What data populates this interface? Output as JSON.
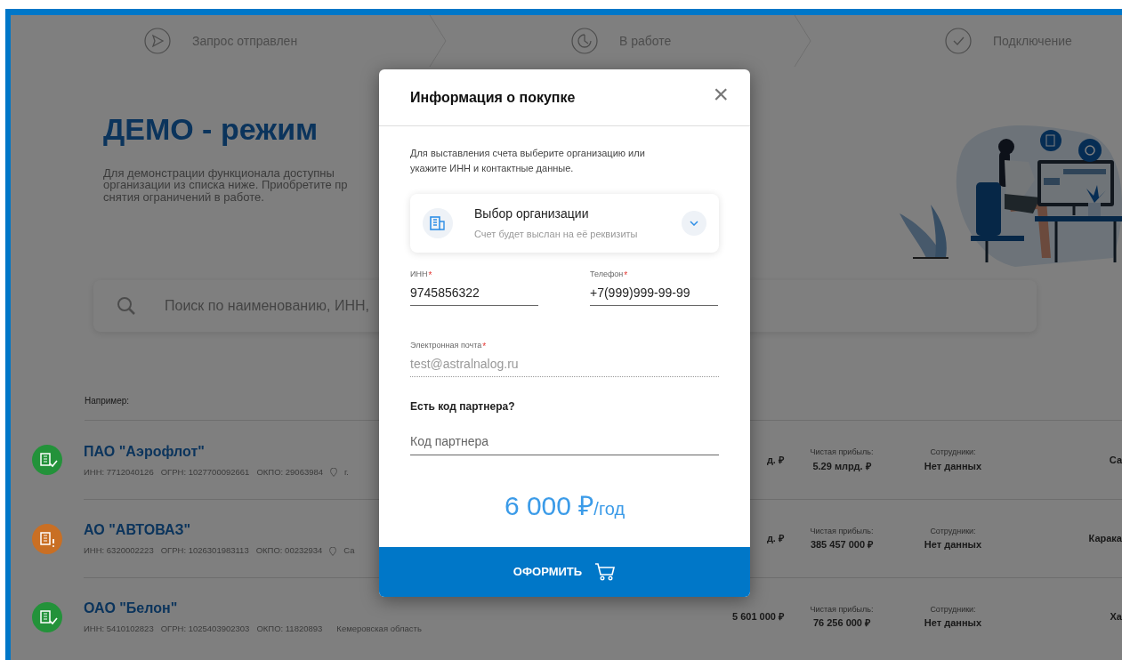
{
  "steps": [
    {
      "label": "Запрос отправлен",
      "kind": "sent"
    },
    {
      "label": "В работе",
      "kind": "progress"
    },
    {
      "label": "Подключение",
      "kind": "done"
    }
  ],
  "hero": {
    "title": "ДЕМО - режим",
    "description_lines": [
      "Для демонстрации функционала доступны",
      "организации из списка ниже. Приобретите пр",
      "снятия ограничений в работе."
    ]
  },
  "search": {
    "placeholder": "Поиск по наименованию, ИНН,"
  },
  "example_label": "Например:",
  "companies": [
    {
      "name": "ПАО \"Аэрофлот\"",
      "kind": "ok",
      "color": "#23923a",
      "inn": "ИНН: 7712040126",
      "ogrn": "ОГРН: 1027700092661",
      "okpo": "ОКПО: 29063984",
      "location": "г.",
      "revenue": "д. ₽",
      "profit_label": "Чистая прибыль:",
      "profit": "5.29 млрд. ₽",
      "staff_label": "Сотрудники:",
      "staff": "Нет данных",
      "column_5": "Са"
    },
    {
      "name": "АО \"АВТОВАЗ\"",
      "kind": "warning",
      "color": "#c96f24",
      "inn": "ИНН: 6320002223",
      "ogrn": "ОГРН: 1026301983113",
      "okpo": "ОКПО: 00232934",
      "location": "Са",
      "revenue": "д. ₽",
      "profit_label": "Чистая прибыль:",
      "profit": "385 457 000 ₽",
      "staff_label": "Сотрудники:",
      "staff": "Нет данных",
      "column_5": "Карака"
    },
    {
      "name": "ОАО \"Белон\"",
      "kind": "ok",
      "color": "#23923a",
      "inn": "ИНН: 5410102823",
      "ogrn": "ОГРН: 1025403902303",
      "okpo": "ОКПО: 11820893",
      "location": "Кемеровская область",
      "revenue": "5 601 000 ₽",
      "profit_label": "Чистая прибыль:",
      "profit": "76 256 000 ₽",
      "staff_label": "Сотрудники:",
      "staff": "Нет данных",
      "column_5": "Ха"
    }
  ],
  "modal": {
    "title": "Информация о покупке",
    "close": "×",
    "intro": "Для выставления счета выберите организацию или укажите ИНН и контактные данные.",
    "org_select": {
      "title": "Выбор организации",
      "subtitle": "Счет будет выслан на её реквизиты"
    },
    "fields": [
      {
        "label": "ИНН",
        "required_mark": "*",
        "value": "9745856322",
        "disabled": false
      },
      {
        "label": "Телефон",
        "required_mark": "*",
        "value": "+7(999)999-99-99",
        "disabled": false
      },
      {
        "label": "Электронная почта",
        "required_mark": "*",
        "value": "test@astralnalog.ru",
        "disabled": true
      }
    ],
    "partner_heading": "Есть код партнера?",
    "partner": {
      "placeholder": "Код партнера"
    },
    "price": {
      "amount": "6 000 ₽",
      "period": "/год"
    },
    "submit": "ОФОРМИТЬ"
  }
}
